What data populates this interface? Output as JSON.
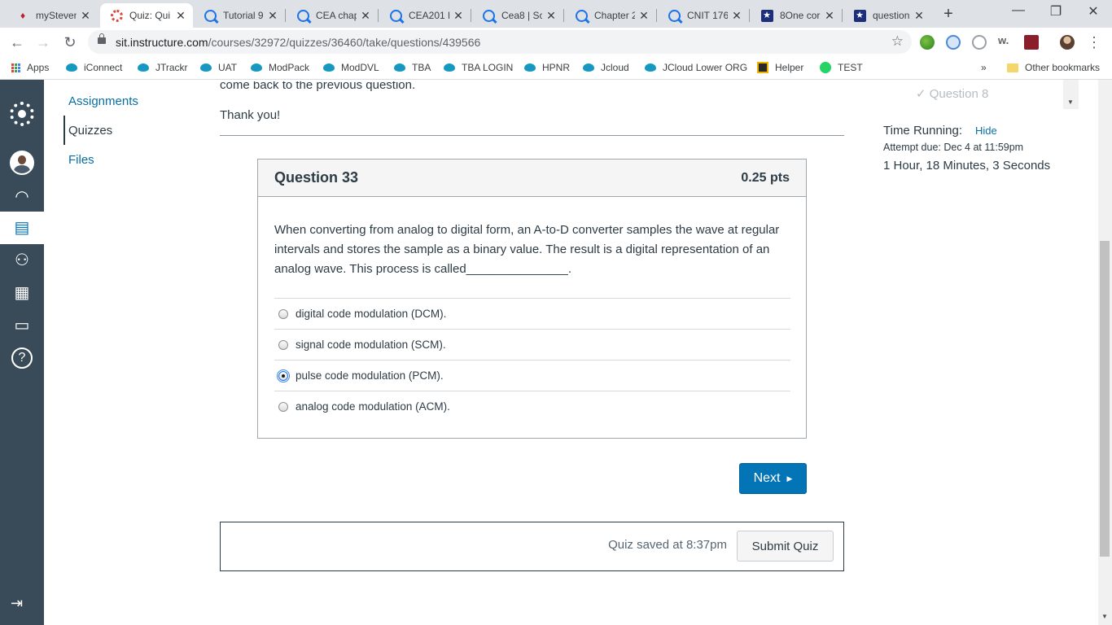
{
  "browser": {
    "tabs": [
      {
        "label": "mySteven",
        "icon": "stevens-icon",
        "active": false
      },
      {
        "label": "Quiz: Qui",
        "icon": "canvas-icon",
        "active": true
      },
      {
        "label": "Tutorial 9",
        "icon": "quizlet-icon",
        "active": false
      },
      {
        "label": "CEA chap",
        "icon": "quizlet-icon",
        "active": false
      },
      {
        "label": "CEA201 L",
        "icon": "quizlet-icon",
        "active": false
      },
      {
        "label": "Cea8 | Sc",
        "icon": "quizlet-icon",
        "active": false
      },
      {
        "label": "Chapter 2",
        "icon": "quizlet-icon",
        "active": false
      },
      {
        "label": "CNIT 176",
        "icon": "quizlet-icon",
        "active": false
      },
      {
        "label": "8One cor",
        "icon": "star-icon",
        "active": false
      },
      {
        "label": "question",
        "icon": "star-icon",
        "active": false
      }
    ],
    "url_host": "sit.instructure.com",
    "url_path": "/courses/32972/quizzes/36460/take/questions/439566",
    "bookmarks": [
      {
        "label": "Apps"
      },
      {
        "label": "iConnect"
      },
      {
        "label": "JTrackr"
      },
      {
        "label": "UAT"
      },
      {
        "label": "ModPack"
      },
      {
        "label": "ModDVL"
      },
      {
        "label": "TBA"
      },
      {
        "label": "TBA LOGIN"
      },
      {
        "label": "HPNR"
      },
      {
        "label": "Jcloud"
      },
      {
        "label": "JCloud Lower ORG"
      },
      {
        "label": "Helper"
      },
      {
        "label": "TEST"
      }
    ],
    "bookmarks_overflow": "»",
    "other_bookmarks": "Other bookmarks"
  },
  "course_nav": {
    "items": [
      {
        "label": "Assignments",
        "active": false
      },
      {
        "label": "Quizzes",
        "active": true
      },
      {
        "label": "Files",
        "active": false
      }
    ]
  },
  "quiz": {
    "cut_text": "come back to the previous question.",
    "thanks": "Thank you!",
    "question_title": "Question 33",
    "points": "0.25 pts",
    "question_text": "When converting from analog to digital form, an A-to-D converter samples the wave at regular intervals and stores the sample as a binary value. The result is a digital representation of an analog wave. This process is called_______________.",
    "answers": [
      {
        "label": "digital code modulation (DCM).",
        "selected": false
      },
      {
        "label": "signal code modulation (SCM).",
        "selected": false
      },
      {
        "label": "pulse code modulation (PCM).",
        "selected": true
      },
      {
        "label": "analog code modulation (ACM).",
        "selected": false
      }
    ],
    "next_label": "Next",
    "saved_text": "Quiz saved at 8:37pm",
    "submit_label": "Submit Quiz"
  },
  "sidebar": {
    "question_list_item": "Question 8",
    "time_label": "Time Running:",
    "hide_label": "Hide",
    "attempt_due": "Attempt due: Dec 4 at 11:59pm",
    "time_value": "1 Hour, 18 Minutes, 3 Seconds"
  },
  "colors": {
    "canvas_nav": "#394b58",
    "link": "#0770a3",
    "primary_button": "#0374b5"
  }
}
